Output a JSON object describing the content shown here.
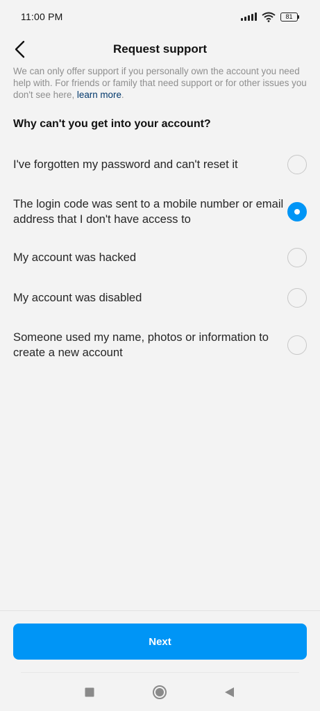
{
  "status_bar": {
    "time": "11:00 PM",
    "battery": "81"
  },
  "header": {
    "title": "Request support",
    "back_icon": "chevron-left-icon"
  },
  "intro": {
    "text": "We can only offer support if you personally own the account you need help with. For friends or family that need support or for other issues you don't see here,",
    "link": "learn more",
    "suffix": "."
  },
  "question": "Why can't you get into your account?",
  "options": [
    {
      "label": "I've forgotten my password and can't reset it",
      "selected": false
    },
    {
      "label": "The login code was sent to a mobile number or email address that I don't have access to",
      "selected": true
    },
    {
      "label": "My account was hacked",
      "selected": false
    },
    {
      "label": "My account was disabled",
      "selected": false
    },
    {
      "label": "Someone used my name, photos or information to create a new account",
      "selected": false
    }
  ],
  "next_label": "Next",
  "colors": {
    "accent": "#0095f6",
    "link": "#00376b",
    "muted": "#8e8e8e"
  },
  "nav": {
    "recents_icon": "square-icon",
    "home_icon": "circle-icon",
    "back_icon": "triangle-back-icon"
  }
}
